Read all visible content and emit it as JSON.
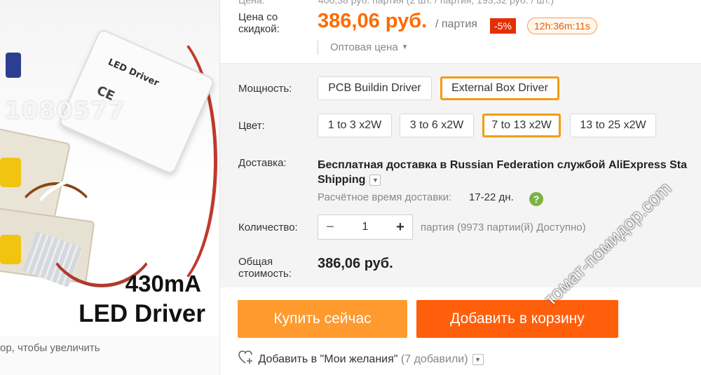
{
  "product_image": {
    "watermark_id": "1080577",
    "driver_label": "LED Driver",
    "ce_mark": "CE",
    "caption_line1": "430mA",
    "caption_line2": "LED Driver",
    "zoom_hint": "ор, чтобы увеличить"
  },
  "price": {
    "cut_top_label": "Цена:",
    "cut_top_text": "406,38 руб. партия (2 шт. / партия, 193,32 руб. / шт.)",
    "discount_label": "Цена со скидкой:",
    "value": "386,06 руб.",
    "unit": "/ партия",
    "discount_badge": "-5%",
    "timer": "12h:36m:11s",
    "wholesale_label": "Оптовая цена"
  },
  "options": {
    "power_label": "Мощность:",
    "power_items": [
      {
        "label": "PCB Buildin Driver",
        "selected": false
      },
      {
        "label": "External Box Driver",
        "selected": true
      }
    ],
    "color_label": "Цвет:",
    "color_items": [
      {
        "label": "1 to 3 x2W",
        "selected": false
      },
      {
        "label": "3 to 6 x2W",
        "selected": false
      },
      {
        "label": "7 to 13 x2W",
        "selected": true
      },
      {
        "label": "13 to 25 x2W",
        "selected": false
      }
    ],
    "accent_color": "#f39c12"
  },
  "shipping": {
    "label": "Доставка:",
    "text_line1": "Бесплатная доставка в Russian Federation службой AliExpress Sta",
    "text_line2": "Shipping",
    "estimate_label": "Расчётное время доставки:",
    "estimate_value": "17-22 дн.",
    "help_icon": "?"
  },
  "quantity": {
    "label": "Количество:",
    "minus": "−",
    "value": "1",
    "plus": "+",
    "availability": "партия (9973 партии(й) Доступно)"
  },
  "total": {
    "label": "Общая стоимость:",
    "value": "386,06 руб."
  },
  "actions": {
    "buy_now": "Купить сейчас",
    "add_to_cart": "Добавить в корзину",
    "buy_color": "#ff9a2e",
    "cart_color": "#ff5f0a"
  },
  "wishlist": {
    "label": "Добавить в \"Мои желания\"",
    "count": "(7 добавили)"
  },
  "site_watermark": "томат-помидор.com"
}
